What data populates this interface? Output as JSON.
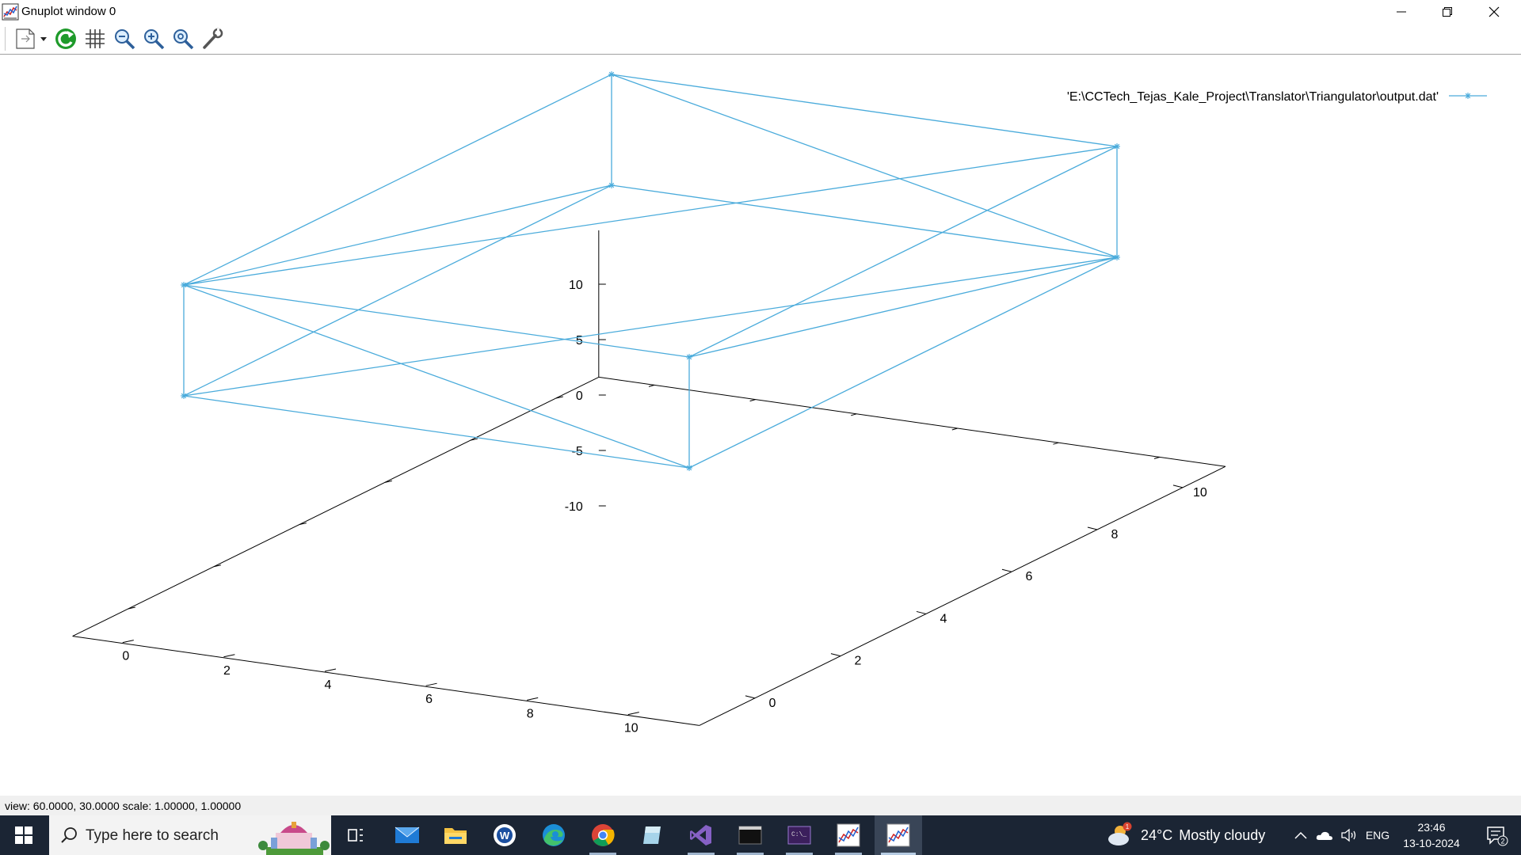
{
  "window": {
    "title": "Gnuplot window 0",
    "controls": [
      "minimize",
      "restore",
      "close"
    ]
  },
  "toolbar": {
    "buttons": [
      "copy-to-clipboard",
      "replot",
      "toggle-grid",
      "zoom-out",
      "zoom-in",
      "autoscale",
      "options"
    ]
  },
  "legend": {
    "label": "'E:\\CCTech_Tejas_Kale_Project\\Translator\\Triangulator\\output.dat'",
    "position": "top-right"
  },
  "chart_data": {
    "type": "line",
    "subtype": "3d-wireframe",
    "view": {
      "rot_x": 60,
      "rot_z": 30,
      "scale": 1,
      "scale_z": 1
    },
    "series": [
      {
        "name": "'E:\\CCTech_Tejas_Kale_Project\\Translator\\Triangulator\\output.dat'",
        "color": "#4aabdb",
        "marker": "star",
        "segments": [
          [
            [
              0,
              0,
              0
            ],
            [
              10,
              0,
              0
            ]
          ],
          [
            [
              10,
              0,
              0
            ],
            [
              10,
              10,
              0
            ]
          ],
          [
            [
              10,
              10,
              0
            ],
            [
              0,
              10,
              0
            ]
          ],
          [
            [
              0,
              10,
              0
            ],
            [
              0,
              0,
              0
            ]
          ],
          [
            [
              0,
              0,
              10
            ],
            [
              10,
              0,
              10
            ]
          ],
          [
            [
              10,
              0,
              10
            ],
            [
              10,
              10,
              10
            ]
          ],
          [
            [
              10,
              10,
              10
            ],
            [
              0,
              10,
              10
            ]
          ],
          [
            [
              0,
              10,
              10
            ],
            [
              0,
              0,
              10
            ]
          ],
          [
            [
              0,
              0,
              0
            ],
            [
              0,
              0,
              10
            ]
          ],
          [
            [
              10,
              0,
              0
            ],
            [
              10,
              0,
              10
            ]
          ],
          [
            [
              10,
              10,
              0
            ],
            [
              10,
              10,
              10
            ]
          ],
          [
            [
              0,
              10,
              0
            ],
            [
              0,
              10,
              10
            ]
          ],
          [
            [
              0,
              0,
              0
            ],
            [
              10,
              10,
              0
            ]
          ],
          [
            [
              0,
              0,
              10
            ],
            [
              10,
              10,
              10
            ]
          ],
          [
            [
              0,
              0,
              10
            ],
            [
              10,
              0,
              0
            ]
          ],
          [
            [
              10,
              0,
              10
            ],
            [
              10,
              10,
              0
            ]
          ],
          [
            [
              0,
              10,
              10
            ],
            [
              10,
              10,
              0
            ]
          ],
          [
            [
              0,
              0,
              10
            ],
            [
              0,
              10,
              0
            ]
          ]
        ]
      }
    ],
    "xlim": [
      0,
      10
    ],
    "ylim": [
      0,
      10
    ],
    "zlim": [
      -10,
      10
    ],
    "xticks": [
      0,
      2,
      4,
      6,
      8,
      10
    ],
    "yticks": [
      0,
      2,
      4,
      6,
      8,
      10
    ],
    "zticks": [
      -10,
      -5,
      0,
      5,
      10
    ],
    "xtick_labels": [
      "0",
      "2",
      "4",
      "6",
      "8",
      "10"
    ],
    "ytick_labels": [
      "0",
      "2",
      "4",
      "6",
      "8",
      "10"
    ],
    "ztick_labels": [
      "-10",
      "-5",
      "0",
      "5",
      "10"
    ],
    "grid": false
  },
  "status": {
    "text": "view: 60.0000,  30.0000   scale: 1.00000,  1.00000"
  },
  "taskbar": {
    "search_placeholder": "Type here to search",
    "apps": [
      "task-view",
      "mail",
      "file-explorer",
      "word-app",
      "edge",
      "chrome",
      "app-tile",
      "visual-studio",
      "terminal",
      "command-prompt",
      "gnuplot-graph",
      "gnuplot-window"
    ],
    "weather_temp": "24°C",
    "weather_desc": "Mostly cloudy",
    "weather_badge": "1",
    "language": "ENG",
    "time": "23:46",
    "date": "13-10-2024",
    "notification_count": "2"
  }
}
